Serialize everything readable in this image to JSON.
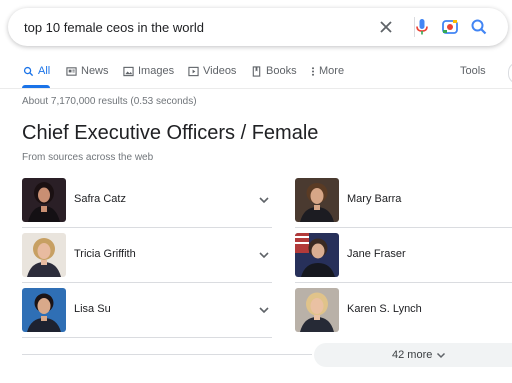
{
  "search": {
    "query": "top 10 female ceos in the world",
    "icons": [
      "close-icon",
      "microphone-icon",
      "lens-icon",
      "search-icon"
    ]
  },
  "tabs": [
    {
      "label": "All",
      "icon": "search-icon",
      "active": true
    },
    {
      "label": "News",
      "icon": "news-icon"
    },
    {
      "label": "Images",
      "icon": "image-icon"
    },
    {
      "label": "Videos",
      "icon": "video-icon"
    },
    {
      "label": "Books",
      "icon": "book-icon"
    },
    {
      "label": "More",
      "icon": "more-vert-icon"
    }
  ],
  "tools_label": "Tools",
  "stats": "About 7,170,000 results (0.53 seconds)",
  "panel": {
    "title": "Chief Executive Officers / Female",
    "subtitle": "From sources across the web",
    "people": [
      {
        "name": "Safra Catz"
      },
      {
        "name": "Tricia Griffith"
      },
      {
        "name": "Lisa Su"
      },
      {
        "name": "Mary Barra"
      },
      {
        "name": "Jane Fraser"
      },
      {
        "name": "Karen S. Lynch"
      }
    ],
    "more_label": "42 more"
  },
  "colors": {
    "accent": "#1a73e8",
    "mic_blue": "#4285f4",
    "mic_red": "#ea4335",
    "lens_yellow": "#fbbc04",
    "lens_green": "#34a853"
  }
}
